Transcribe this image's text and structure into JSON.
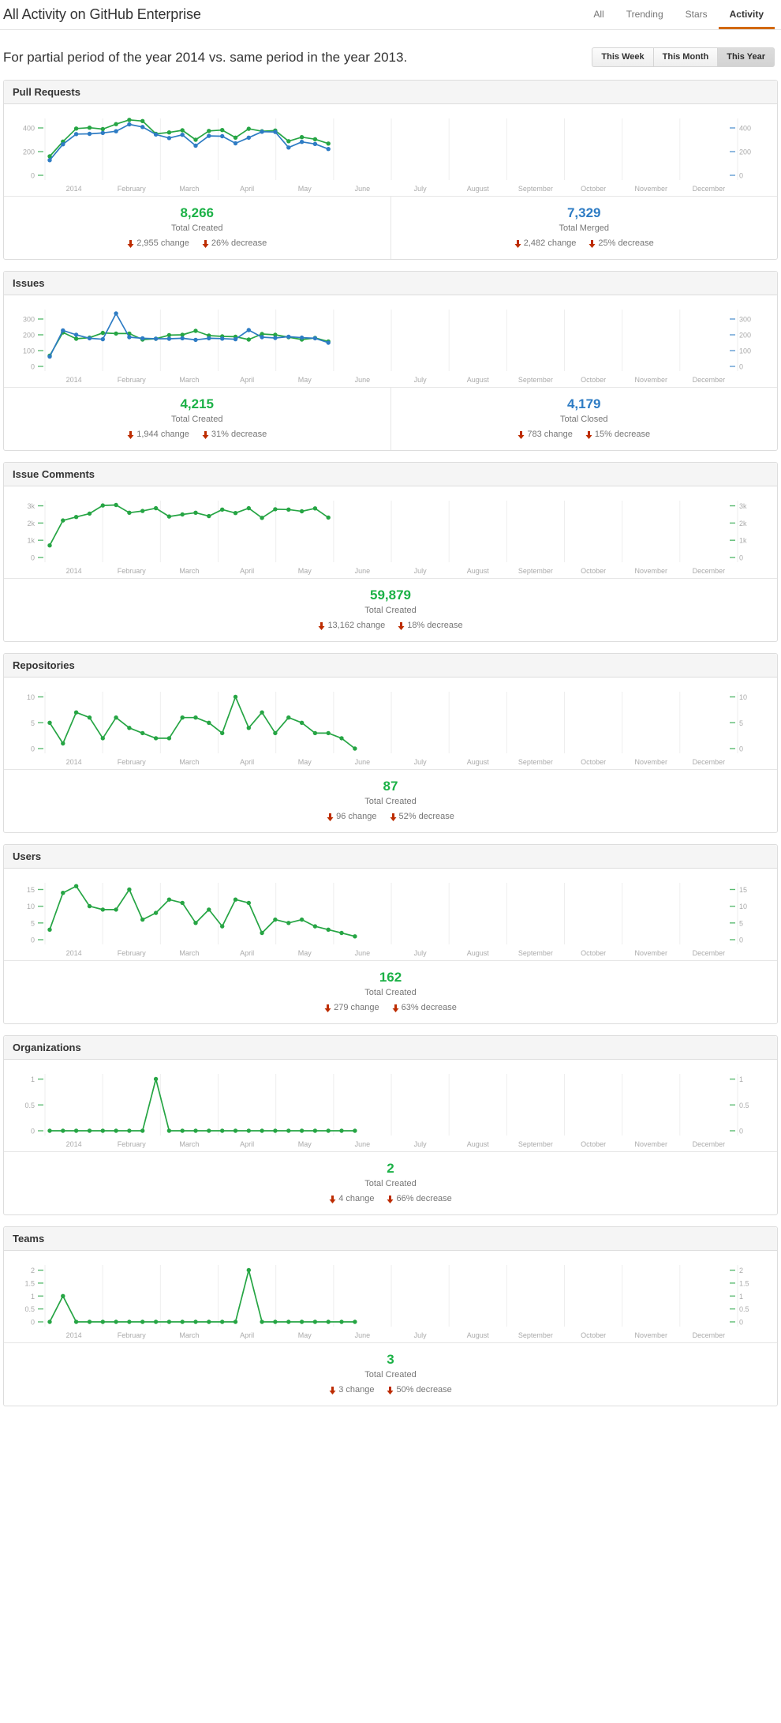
{
  "header": {
    "title": "All Activity on GitHub Enterprise",
    "tabs": [
      {
        "label": "All",
        "active": false
      },
      {
        "label": "Trending",
        "active": false
      },
      {
        "label": "Stars",
        "active": false
      },
      {
        "label": "Activity",
        "active": true
      }
    ]
  },
  "subheader": {
    "description": "For partial period of the year 2014 vs. same period in the year 2013.",
    "range_buttons": [
      {
        "label": "This Week",
        "selected": false
      },
      {
        "label": "This Month",
        "selected": false
      },
      {
        "label": "This Year",
        "selected": true
      }
    ]
  },
  "colors": {
    "green": "#26a544",
    "blue": "#2e7cc4",
    "red": "#bd2c00",
    "grid": "#eeeeee",
    "axis_text": "#aaaaaa"
  },
  "icons": {
    "decrease": "arrow-down-icon"
  },
  "months": [
    "2014",
    "February",
    "March",
    "April",
    "May",
    "June",
    "July",
    "August",
    "September",
    "October",
    "November",
    "December"
  ],
  "panels": [
    {
      "title": "Pull Requests",
      "stats": [
        {
          "value": "8,266",
          "label": "Total Created",
          "color": "green",
          "changes": [
            "2,955 change",
            "26% decrease"
          ]
        },
        {
          "value": "7,329",
          "label": "Total Merged",
          "color": "blue",
          "changes": [
            "2,482 change",
            "25% decrease"
          ]
        }
      ]
    },
    {
      "title": "Issues",
      "stats": [
        {
          "value": "4,215",
          "label": "Total Created",
          "color": "green",
          "changes": [
            "1,944 change",
            "31% decrease"
          ]
        },
        {
          "value": "4,179",
          "label": "Total Closed",
          "color": "blue",
          "changes": [
            "783 change",
            "15% decrease"
          ]
        }
      ]
    },
    {
      "title": "Issue Comments",
      "stats": [
        {
          "value": "59,879",
          "label": "Total Created",
          "color": "green",
          "changes": [
            "13,162 change",
            "18% decrease"
          ]
        }
      ]
    },
    {
      "title": "Repositories",
      "stats": [
        {
          "value": "87",
          "label": "Total Created",
          "color": "green",
          "changes": [
            "96 change",
            "52% decrease"
          ]
        }
      ]
    },
    {
      "title": "Users",
      "stats": [
        {
          "value": "162",
          "label": "Total Created",
          "color": "green",
          "changes": [
            "279 change",
            "63% decrease"
          ]
        }
      ]
    },
    {
      "title": "Organizations",
      "stats": [
        {
          "value": "2",
          "label": "Total Created",
          "color": "green",
          "changes": [
            "4 change",
            "66% decrease"
          ]
        }
      ]
    },
    {
      "title": "Teams",
      "stats": [
        {
          "value": "3",
          "label": "Total Created",
          "color": "green",
          "changes": [
            "3 change",
            "50% decrease"
          ]
        }
      ]
    }
  ],
  "chart_data": [
    {
      "type": "line",
      "title": "Pull Requests",
      "xlabel": "",
      "ylabel": "",
      "grid": true,
      "legend": "none",
      "x_tick_labels": [
        "2014",
        "February",
        "March",
        "April",
        "May",
        "June",
        "July",
        "August",
        "September",
        "October",
        "November",
        "December"
      ],
      "y_ticks_left": [
        0,
        200,
        400
      ],
      "y_ticks_right": [
        0,
        200,
        400
      ],
      "ylim": [
        0,
        480
      ],
      "x_points": 24,
      "series": [
        {
          "name": "Created",
          "color": "#26a544",
          "values": [
            160,
            285,
            395,
            402,
            390,
            432,
            468,
            458,
            350,
            362,
            380,
            300,
            375,
            382,
            318,
            393,
            372,
            378,
            288,
            322,
            305,
            268,
            null,
            null
          ]
        },
        {
          "name": "Merged",
          "color": "#2e7cc4",
          "values": [
            128,
            262,
            348,
            350,
            358,
            372,
            430,
            408,
            345,
            315,
            342,
            250,
            333,
            330,
            270,
            318,
            368,
            366,
            235,
            282,
            265,
            222,
            null,
            null
          ]
        }
      ]
    },
    {
      "type": "line",
      "title": "Issues",
      "xlabel": "",
      "ylabel": "",
      "grid": true,
      "legend": "none",
      "x_tick_labels": [
        "2014",
        "February",
        "March",
        "April",
        "May",
        "June",
        "July",
        "August",
        "September",
        "October",
        "November",
        "December"
      ],
      "y_ticks_left": [
        0,
        100,
        200,
        300
      ],
      "y_ticks_right": [
        0,
        100,
        200,
        300
      ],
      "ylim": [
        0,
        360
      ],
      "x_points": 24,
      "series": [
        {
          "name": "Created",
          "color": "#26a544",
          "values": [
            68,
            215,
            175,
            182,
            212,
            208,
            208,
            170,
            175,
            198,
            200,
            225,
            195,
            190,
            188,
            170,
            205,
            200,
            185,
            170,
            180,
            158,
            null,
            null
          ]
        },
        {
          "name": "Closed",
          "color": "#2e7cc4",
          "values": [
            62,
            228,
            200,
            178,
            172,
            335,
            185,
            178,
            175,
            175,
            178,
            168,
            178,
            176,
            172,
            230,
            185,
            180,
            188,
            182,
            178,
            150,
            null,
            null
          ]
        }
      ]
    },
    {
      "type": "line",
      "title": "Issue Comments",
      "xlabel": "",
      "ylabel": "",
      "grid": true,
      "legend": "none",
      "x_tick_labels": [
        "2014",
        "February",
        "March",
        "April",
        "May",
        "June",
        "July",
        "August",
        "September",
        "October",
        "November",
        "December"
      ],
      "y_ticks_left": [
        0,
        1000,
        2000,
        3000
      ],
      "y_tick_labels_left": [
        "0",
        "1k",
        "2k",
        "3k"
      ],
      "y_ticks_right": [
        0,
        1000,
        2000,
        3000
      ],
      "y_tick_labels_right": [
        "0",
        "1k",
        "2k",
        "3k"
      ],
      "ylim": [
        0,
        3300
      ],
      "x_points": 24,
      "series": [
        {
          "name": "Created",
          "color": "#26a544",
          "values": [
            700,
            2150,
            2350,
            2550,
            3020,
            3050,
            2600,
            2700,
            2860,
            2380,
            2500,
            2600,
            2400,
            2780,
            2580,
            2860,
            2300,
            2800,
            2780,
            2680,
            2850,
            2320,
            null,
            null
          ]
        }
      ]
    },
    {
      "type": "line",
      "title": "Repositories",
      "xlabel": "",
      "ylabel": "",
      "grid": true,
      "legend": "none",
      "x_tick_labels": [
        "2014",
        "February",
        "March",
        "April",
        "May",
        "June",
        "July",
        "August",
        "September",
        "October",
        "November",
        "December"
      ],
      "y_ticks_left": [
        0,
        5,
        10
      ],
      "y_ticks_right": [
        0,
        5,
        10
      ],
      "ylim": [
        0,
        11
      ],
      "x_points": 24,
      "series": [
        {
          "name": "Created",
          "color": "#26a544",
          "values": [
            5,
            1,
            7,
            6,
            2,
            6,
            4,
            3,
            2,
            2,
            6,
            6,
            5,
            3,
            10,
            4,
            7,
            3,
            6,
            5,
            3,
            3,
            2,
            0
          ]
        }
      ]
    },
    {
      "type": "line",
      "title": "Users",
      "xlabel": "",
      "ylabel": "",
      "grid": true,
      "legend": "none",
      "x_tick_labels": [
        "2014",
        "February",
        "March",
        "April",
        "May",
        "June",
        "July",
        "August",
        "September",
        "October",
        "November",
        "December"
      ],
      "y_ticks_left": [
        0,
        5,
        10,
        15
      ],
      "y_ticks_right": [
        0,
        5,
        10,
        15
      ],
      "ylim": [
        0,
        17
      ],
      "x_points": 24,
      "series": [
        {
          "name": "Created",
          "color": "#26a544",
          "values": [
            3,
            14,
            16,
            10,
            9,
            9,
            15,
            6,
            8,
            12,
            11,
            5,
            9,
            4,
            12,
            11,
            2,
            6,
            5,
            6,
            4,
            3,
            2,
            1
          ]
        }
      ]
    },
    {
      "type": "line",
      "title": "Organizations",
      "xlabel": "",
      "ylabel": "",
      "grid": true,
      "legend": "none",
      "x_tick_labels": [
        "2014",
        "February",
        "March",
        "April",
        "May",
        "June",
        "July",
        "August",
        "September",
        "October",
        "November",
        "December"
      ],
      "y_ticks_left": [
        0,
        0.5,
        1
      ],
      "y_tick_labels_left": [
        "0",
        "0.5",
        "1"
      ],
      "y_ticks_right": [
        0,
        0.5,
        1
      ],
      "y_tick_labels_right": [
        "0",
        "0.5",
        "1"
      ],
      "ylim": [
        0,
        1.1
      ],
      "x_points": 24,
      "series": [
        {
          "name": "Created",
          "color": "#26a544",
          "values": [
            0,
            0,
            0,
            0,
            0,
            0,
            0,
            0,
            1,
            0,
            0,
            0,
            0,
            0,
            0,
            0,
            0,
            0,
            0,
            0,
            0,
            0,
            0,
            0
          ]
        }
      ]
    },
    {
      "type": "line",
      "title": "Teams",
      "xlabel": "",
      "ylabel": "",
      "grid": true,
      "legend": "none",
      "x_tick_labels": [
        "2014",
        "February",
        "March",
        "April",
        "May",
        "June",
        "July",
        "August",
        "September",
        "October",
        "November",
        "December"
      ],
      "y_ticks_left": [
        0,
        0.5,
        1,
        1.5,
        2
      ],
      "y_tick_labels_left": [
        "0",
        "0.5",
        "1",
        "1.5",
        "2"
      ],
      "y_ticks_right": [
        0,
        0.5,
        1,
        1.5,
        2
      ],
      "y_tick_labels_right": [
        "0",
        "0.5",
        "1",
        "1.5",
        "2"
      ],
      "ylim": [
        0,
        2.2
      ],
      "x_points": 24,
      "series": [
        {
          "name": "Created",
          "color": "#26a544",
          "values": [
            0,
            1,
            0,
            0,
            0,
            0,
            0,
            0,
            0,
            0,
            0,
            0,
            0,
            0,
            0,
            2,
            0,
            0,
            0,
            0,
            0,
            0,
            0,
            0
          ]
        }
      ]
    }
  ]
}
